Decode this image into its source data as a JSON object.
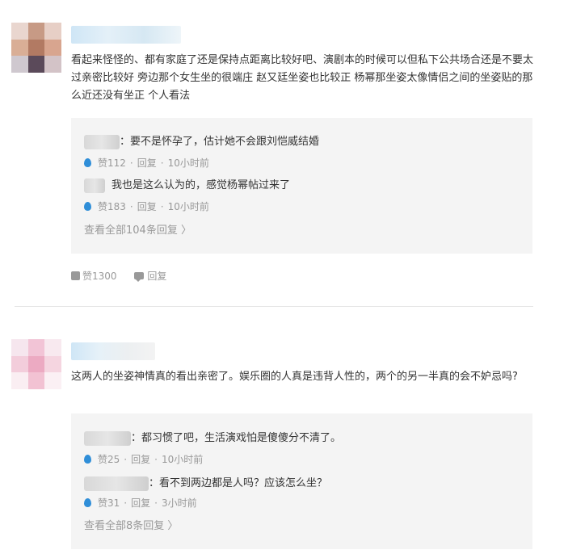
{
  "comments": [
    {
      "text": "看起来怪怪的、都有家庭了还是保持点距离比较好吧、演剧本的时候可以但私下公共场合还是不要太过亲密比较好 旁边那个女生坐的很端庄 赵又廷坐姿也比较正 杨幂那坐姿太像情侣之间的坐姿贴的那么近还没有坐正 个人看法",
      "replies": [
        {
          "text": "：要不是怀孕了，估计她不会跟刘恺威结婚",
          "likes": "赞112",
          "reply_label": "回复",
          "time": "10小时前"
        },
        {
          "text": "我也是这么认为的，感觉杨幂帖过来了",
          "likes": "赞183",
          "reply_label": "回复",
          "time": "10小时前"
        }
      ],
      "view_all": "查看全部104条回复 〉",
      "likes": "赞1300",
      "reply_label": "回复"
    },
    {
      "text": "这两人的坐姿神情真的看出亲密了。娱乐圈的人真是违背人性的，两个的另一半真的会不妒忌吗?",
      "replies": [
        {
          "text": "：都习惯了吧，生活演戏怕是傻傻分不清了。",
          "likes": "赞25",
          "reply_label": "回复",
          "time": "10小时前"
        },
        {
          "text": "：看不到两边都是人吗？应该怎么坐？",
          "likes": "赞31",
          "reply_label": "回复",
          "time": "3小时前"
        }
      ],
      "view_all": "查看全部8条回复 〉"
    }
  ],
  "colors": {
    "accent": "#2f8ed8",
    "meta": "#999999",
    "panel": "#f4f4f4"
  }
}
